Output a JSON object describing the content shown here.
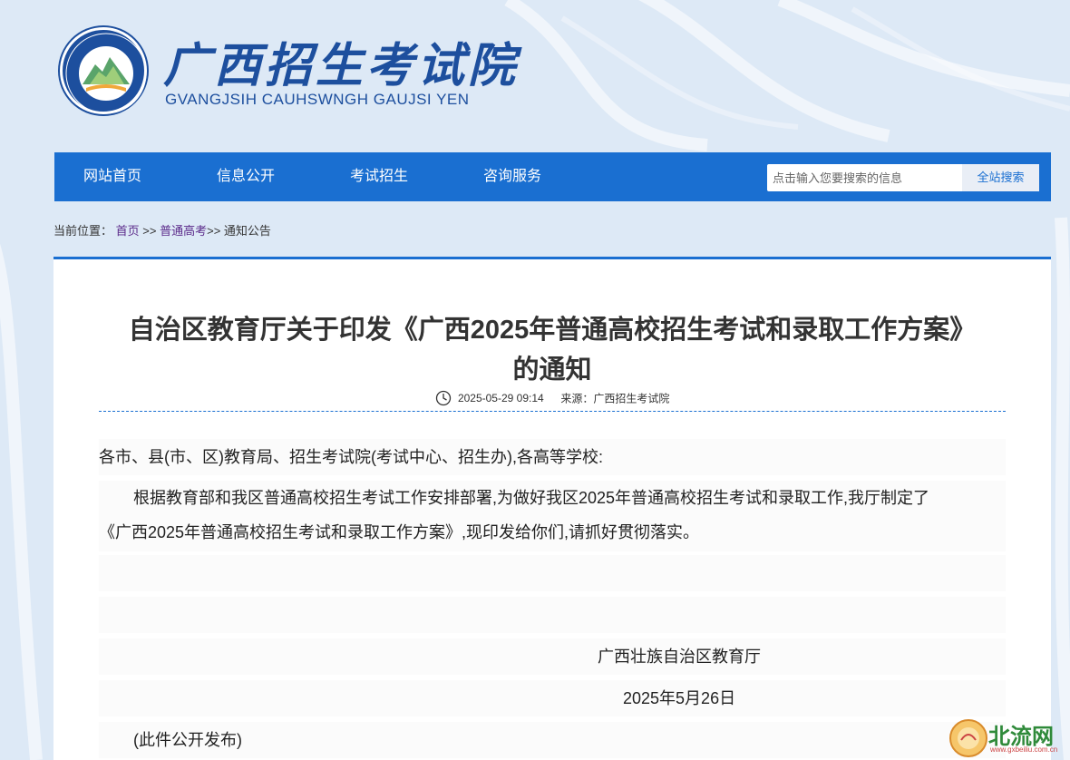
{
  "header": {
    "logo_cn": "广西招生考试院",
    "logo_en": "GVANGJSIH CAUHSWNGH GAUJSI YEN",
    "seal_text": "广西招生考试院 GVANGJSIH CAUHSWNGH GAUJSI YEN"
  },
  "nav": {
    "items": [
      {
        "label": "网站首页"
      },
      {
        "label": "信息公开"
      },
      {
        "label": "考试招生"
      },
      {
        "label": "咨询服务"
      }
    ],
    "search": {
      "placeholder": "点击输入您要搜索的信息",
      "button_label": "全站搜索"
    }
  },
  "breadcrumb": {
    "prefix": "当前位置：",
    "items": [
      "首页",
      "普通高考",
      "通知公告"
    ],
    "separator": ">>"
  },
  "article": {
    "title_line1": "自治区教育厅关于印发《广西2025年普通高校招生考试和录取工作方案》",
    "title_line2": "的通知",
    "datetime": "2025-05-29 09:14",
    "source_label": "来源：",
    "source": "广西招生考试院",
    "salutation": "各市、县(市、区)教育局、招生考试院(考试中心、招生办),各高等学校:",
    "body_line1": "根据教育部和我区普通高校招生考试工作安排部署,为做好我区2025年普通高校招生考试和录取工作,我厅制定了",
    "body_line2": "《广西2025年普通高校招生考试和录取工作方案》,现印发给你们,请抓好贯彻落实。",
    "signature": "广西壮族自治区教育厅",
    "sign_date": "2025年5月26日",
    "public_note": "(此件公开发布)"
  },
  "watermark": {
    "text": "北流网",
    "url": "www.gxbeiliu.com.cn"
  },
  "colors": {
    "primary_blue": "#1a6fd1",
    "logo_blue": "#1d4f9e",
    "breadcrumb_link": "#5b2a8a"
  }
}
